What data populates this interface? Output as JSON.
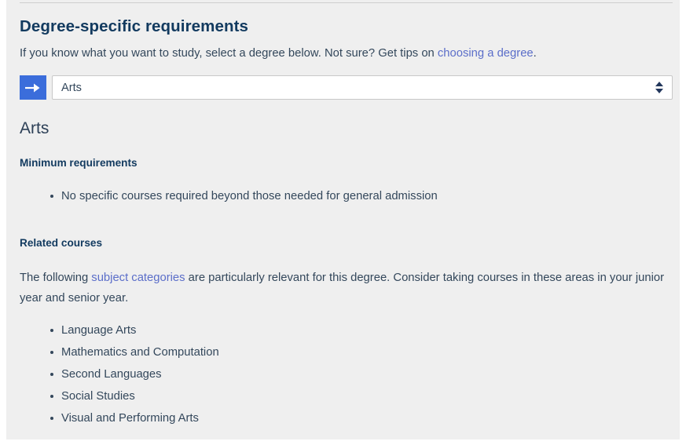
{
  "page": {
    "title": "Degree-specific requirements",
    "intro": {
      "before_link": "If you know what you want to study, select a degree below. Not sure? Get tips on ",
      "link_text": "choosing a degree",
      "after_link": "."
    }
  },
  "selector": {
    "go_button_icon": "arrow-right-icon",
    "selected_degree": "Arts",
    "options": [
      "Arts"
    ],
    "spinner_up_icon": "triangle-up-icon",
    "spinner_down_icon": "triangle-down-icon"
  },
  "degree": {
    "name": "Arts",
    "minimum": {
      "heading": "Minimum requirements",
      "items": [
        "No specific courses required beyond those needed for general admission"
      ]
    },
    "related": {
      "heading": "Related courses",
      "paragraph": {
        "before_link": "The following ",
        "link_text": "subject categories",
        "after_link": " are particularly relevant for this degree. Consider taking courses in these areas in your junior year and senior year."
      },
      "items": [
        "Language Arts",
        "Mathematics and Computation",
        "Second Languages",
        "Social Studies",
        "Visual and Performing Arts"
      ]
    }
  },
  "colors": {
    "panel_background": "#efefef",
    "page_background": "#ffffff",
    "heading": "#123a5f",
    "body_text": "#33475b",
    "link": "#5b6ec9",
    "button_blue": "#3b6ddb",
    "rule": "#cfcfcf",
    "select_border": "#c8c8c8",
    "spinner": "#22375c"
  }
}
